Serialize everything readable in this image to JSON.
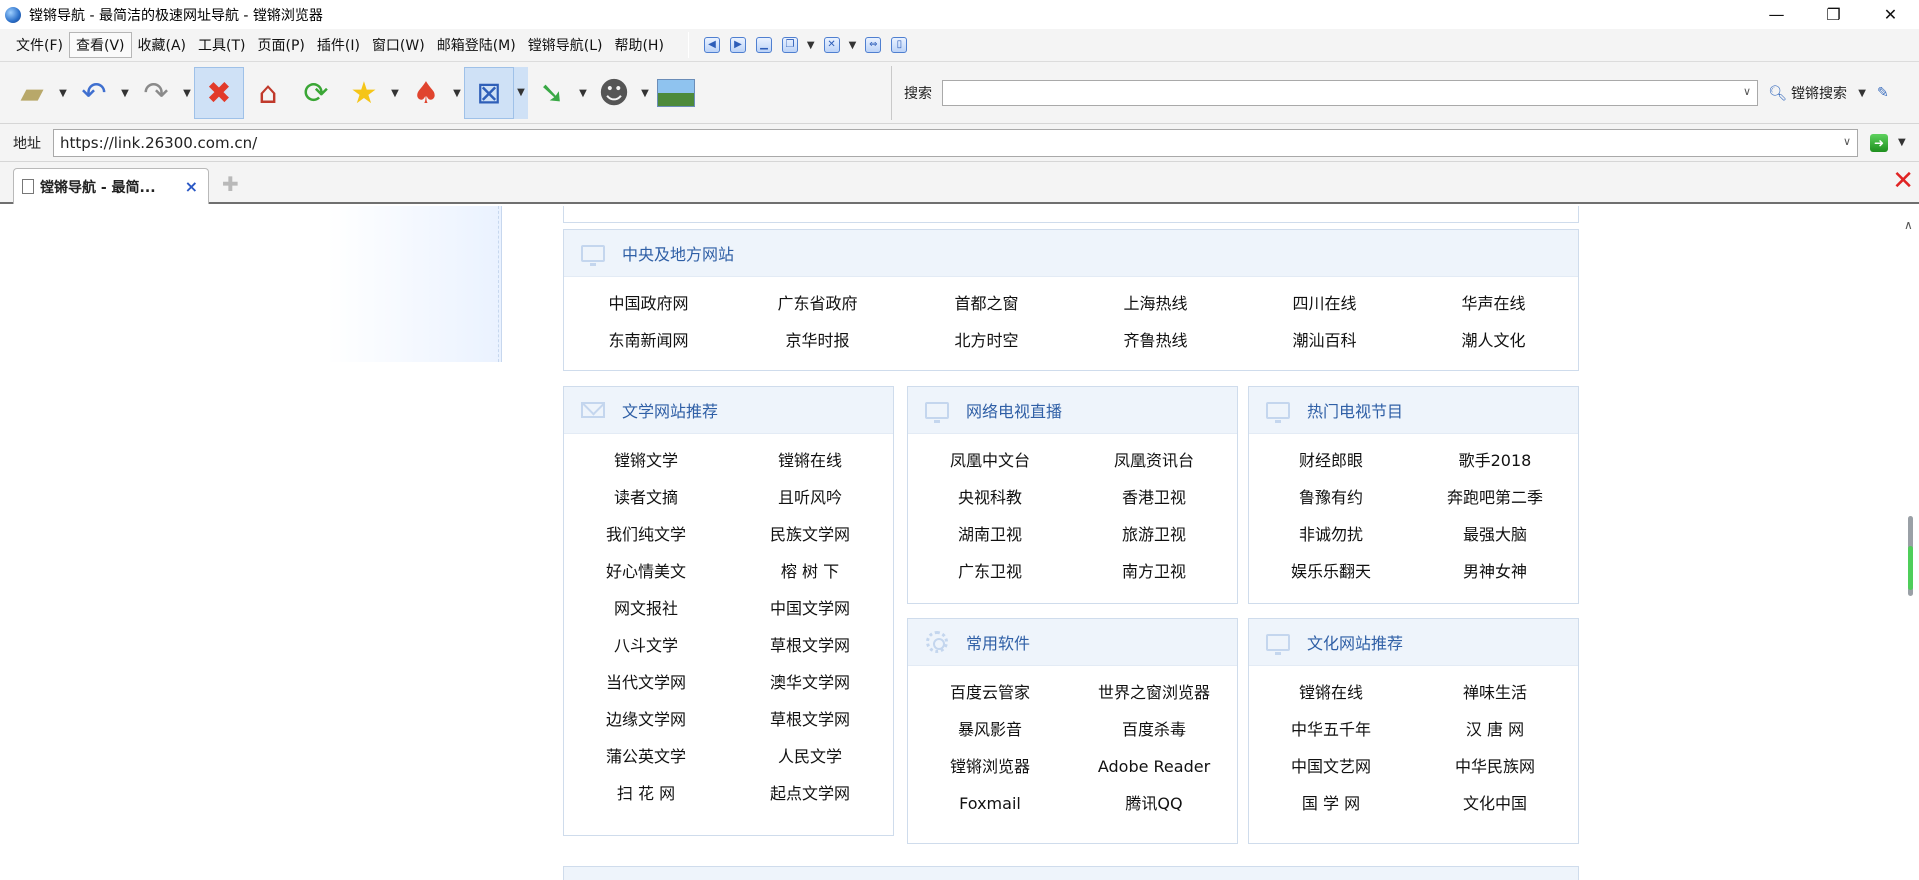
{
  "window": {
    "title": "镗锵导航 - 最简洁的极速网址导航 - 镗锵浏览器",
    "controls": [
      "—",
      "❐",
      "✕"
    ]
  },
  "menubar": {
    "items": [
      "文件(F)",
      "查看(V)",
      "收藏(A)",
      "工具(T)",
      "页面(P)",
      "插件(I)",
      "窗口(W)",
      "邮箱登陆(M)",
      "镗锵导航(L)",
      "帮助(H)"
    ],
    "active_index": 1
  },
  "toolbar": {
    "search_label": "搜索",
    "search_value": "",
    "search_button": "镗锵搜索"
  },
  "address": {
    "label": "地址",
    "url": "https://link.26300.com.cn/"
  },
  "tabs": [
    {
      "label": "镗锵导航 - 最简...",
      "active": true
    }
  ],
  "sections": {
    "central": {
      "title": "中央及地方网站",
      "links": [
        "中国政府网",
        "广东省政府",
        "首都之窗",
        "上海热线",
        "四川在线",
        "华声在线",
        "东南新闻网",
        "京华时报",
        "北方时空",
        "齐鲁热线",
        "潮汕百科",
        "潮人文化"
      ]
    },
    "literature": {
      "title": "文学网站推荐",
      "links": [
        "镗锵文学",
        "镗锵在线",
        "读者文摘",
        "且听风吟",
        "我们纯文学",
        "民族文学网",
        "好心情美文",
        "榕 树 下",
        "网文报社",
        "中国文学网",
        "八斗文学",
        "草根文学网",
        "当代文学网",
        "澳华文学网",
        "边缘文学网",
        "草根文学网",
        "蒲公英文学",
        "人民文学",
        "扫 花 网",
        "起点文学网"
      ]
    },
    "tv_live": {
      "title": "网络电视直播",
      "links": [
        "凤凰中文台",
        "凤凰资讯台",
        "央视科教",
        "香港卫视",
        "湖南卫视",
        "旅游卫视",
        "广东卫视",
        "南方卫视"
      ]
    },
    "hot_tv": {
      "title": "热门电视节目",
      "links": [
        "财经郎眼",
        "歌手2018",
        "鲁豫有约",
        "奔跑吧第二季",
        "非诚勿扰",
        "最强大脑",
        "娱乐乐翻天",
        "男神女神"
      ]
    },
    "software": {
      "title": "常用软件",
      "links": [
        "百度云管家",
        "世界之窗浏览器",
        "暴风影音",
        "百度杀毒",
        "镗锵浏览器",
        "Adobe Reader",
        "Foxmail",
        "腾讯QQ"
      ]
    },
    "culture": {
      "title": "文化网站推荐",
      "links": [
        "镗锵在线",
        "禅味生活",
        "中华五千年",
        "汉 唐 网",
        "中国文艺网",
        "中华民族网",
        "国 学 网",
        "文化中国"
      ]
    }
  },
  "colors": {
    "section_title": "#2f5fa6",
    "section_head_bg": "#eef4fb",
    "border": "#cfdcec"
  }
}
